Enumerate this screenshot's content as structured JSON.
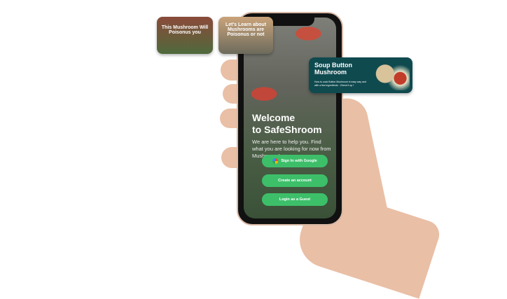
{
  "screen": {
    "title_line1": "Welcome",
    "title_line2": "to SafeShroom",
    "subtitle": "We are here to help you. Find what you are looking for now from Mushroom !",
    "buttons": {
      "google": "Sign In with Google",
      "create": "Create an account",
      "guest": "Login as a Guest"
    }
  },
  "cards": [
    {
      "text": "This Mushroom Will Poisonus you"
    },
    {
      "text": "Let's Learn about Mushrooms are Poisonus or not"
    },
    {
      "title": "Soup Button Mushroom",
      "desc": "How to cook Button Mushroom in easy way and with a few ingredients . Check it up !"
    }
  ],
  "colors": {
    "accent": "#3dbf6a",
    "card": "#0f4a4f"
  }
}
